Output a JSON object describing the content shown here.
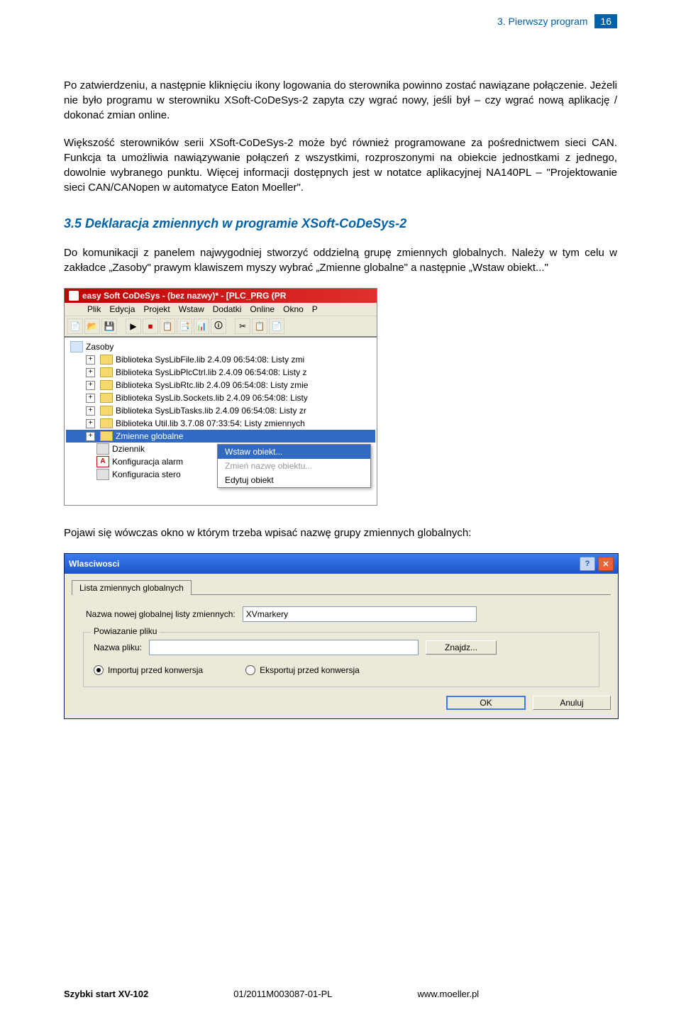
{
  "header": {
    "section": "3. Pierwszy program",
    "page_num": "16"
  },
  "para1": "Po zatwierdzeniu, a następnie kliknięciu ikony logowania do sterownika powinno zostać nawiązane połączenie. Jeżeli nie było programu w sterowniku XSoft-CoDeSys-2 zapyta czy wgrać nowy, jeśli był – czy wgrać nową aplikację / dokonać zmian online.",
  "para2": "Większość sterowników serii XSoft-CoDeSys-2 może być również programowane za pośrednictwem sieci CAN. Funkcja ta umożliwia nawiązywanie połączeń z wszystkimi, rozproszonymi na obiekcie jednostkami z jednego, dowolnie wybranego punktu. Więcej informacji dostępnych jest w notatce aplikacyjnej NA140PL – \"Projektowanie sieci CAN/CANopen w automatyce Eaton Moeller\".",
  "section_heading": "3.5  Deklaracja zmiennych w programie XSoft-CoDeSys-2",
  "para3": "Do komunikacji z panelem najwygodniej stworzyć oddzielną grupę zmiennych globalnych. Należy w tym celu w zakładce „Zasoby\" prawym klawiszem myszy wybrać „Zmienne globalne\" a następnie „Wstaw obiekt...\"",
  "shot1": {
    "title": "easy Soft CoDeSys - (bez nazwy)* - [PLC_PRG (PR",
    "menus": {
      "plik": "Plik",
      "edycja": "Edycja",
      "projekt": "Projekt",
      "wstaw": "Wstaw",
      "dodatki": "Dodatki",
      "online": "Online",
      "okno": "Okno",
      "p": "P"
    },
    "tree": {
      "root": "Zasoby",
      "items": [
        "Biblioteka SysLibFile.lib 2.4.09 06:54:08: Listy zmi",
        "Biblioteka SysLibPlcCtrl.lib 2.4.09 06:54:08: Listy z",
        "Biblioteka SysLibRtc.lib 2.4.09 06:54:08: Listy zmie",
        "Biblioteka SysLib.Sockets.lib 2.4.09 06:54:08: Listy",
        "Biblioteka SysLibTasks.lib 2.4.09 06:54:08: Listy zr",
        "Biblioteka Util.lib 3.7.08 07:33:54: Listy zmiennych",
        "Zmienne globalne",
        "Dziennik",
        "Konfiguracja alarm",
        "Konfiguracia stero"
      ]
    },
    "ctx": {
      "insert": "Wstaw obiekt...",
      "rename": "Zmień nazwę obiektu...",
      "edit": "Edytuj obiekt"
    }
  },
  "para4": "Pojawi się wówczas okno  w którym trzeba wpisać nazwę grupy zmiennych globalnych:",
  "shot2": {
    "title": "Wlasciwosci",
    "tab": "Lista zmiennych globalnych",
    "label_name": "Nazwa nowej globalnej listy zmiennych:",
    "value_name": "XVmarkery",
    "group_legend": "Powiazanie pliku",
    "label_file": "Nazwa pliku:",
    "value_file": "",
    "btn_browse": "Znajdz...",
    "radio_import": "Importuj przed konwersja",
    "radio_export": "Eksportuj przed konwersja",
    "btn_ok": "OK",
    "btn_cancel": "Anuluj"
  },
  "footer": {
    "t1": "Szybki start XV-102",
    "t2": "01/2011M003087-01-PL",
    "t3": "www.moeller.pl"
  }
}
